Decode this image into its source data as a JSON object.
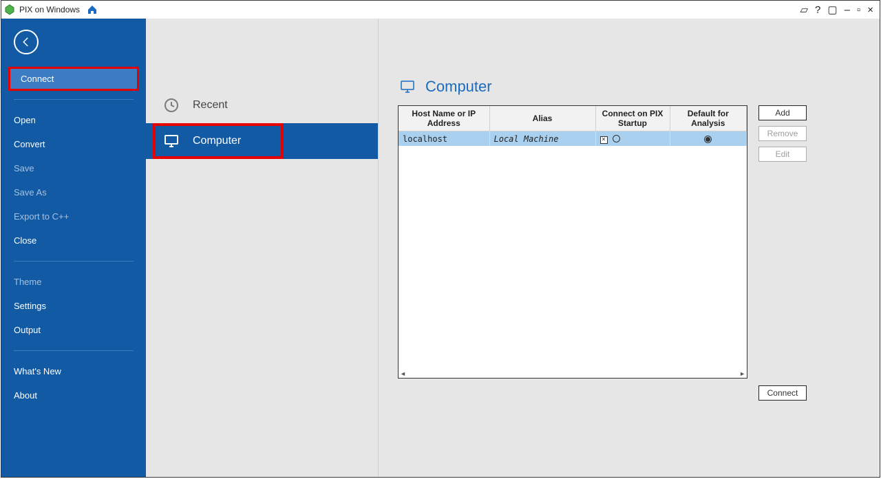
{
  "titlebar": {
    "title": "PIX on Windows"
  },
  "sidebar": {
    "connect": "Connect",
    "open": "Open",
    "convert": "Convert",
    "save": "Save",
    "save_as": "Save As",
    "export_cpp": "Export to C++",
    "close": "Close",
    "theme": "Theme",
    "settings": "Settings",
    "output": "Output",
    "whats_new": "What's New",
    "about": "About"
  },
  "page": {
    "title": "Connect"
  },
  "midlist": {
    "recent": "Recent",
    "computer": "Computer"
  },
  "main": {
    "head": "Computer",
    "headers": {
      "host": "Host Name or IP Address",
      "alias": "Alias",
      "startup": "Connect on PIX Startup",
      "default": "Default for Analysis"
    },
    "rows": [
      {
        "host": "localhost",
        "alias": "Local Machine",
        "startup_checked": true,
        "startup_radio": false,
        "default": true
      }
    ],
    "buttons": {
      "add": "Add",
      "remove": "Remove",
      "edit": "Edit",
      "connect": "Connect"
    }
  }
}
